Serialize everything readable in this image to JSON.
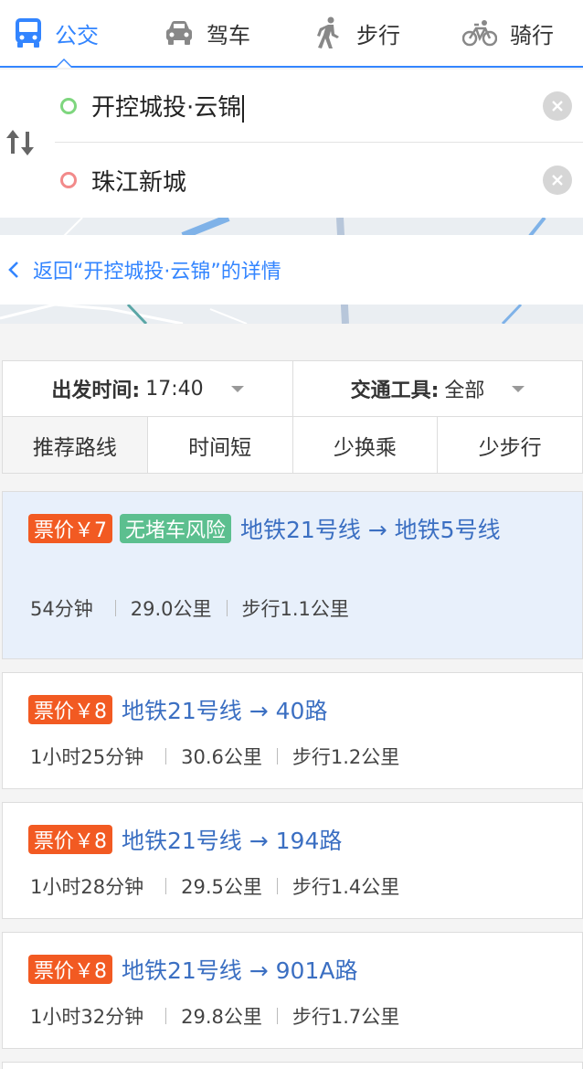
{
  "mode_tabs": [
    {
      "label": "公交",
      "icon": "bus-icon",
      "active": true
    },
    {
      "label": "驾车",
      "icon": "car-icon",
      "active": false
    },
    {
      "label": "步行",
      "icon": "walk-icon",
      "active": false
    },
    {
      "label": "骑行",
      "icon": "bike-icon",
      "active": false
    }
  ],
  "route": {
    "start": "开控城投·云锦",
    "end": "珠江新城"
  },
  "back_link": "返回“开控城投·云锦”的详情",
  "filters": {
    "depart_label": "出发时间:",
    "depart_value": "17:40",
    "vehicle_label": "交通工具:",
    "vehicle_value": "全部"
  },
  "sort_tabs": [
    "推荐路线",
    "时间短",
    "少换乘",
    "少步行"
  ],
  "results": [
    {
      "price": "票价￥7",
      "tag": "无堵车风险",
      "name": "地铁21号线 → 地铁5号线",
      "duration": "54分钟",
      "distance": "29.0公里",
      "walk": "步行1.1公里"
    },
    {
      "price": "票价￥8",
      "name": "地铁21号线 → 40路",
      "duration": "1小时25分钟",
      "distance": "30.6公里",
      "walk": "步行1.2公里"
    },
    {
      "price": "票价￥8",
      "name": "地铁21号线 → 194路",
      "duration": "1小时28分钟",
      "distance": "29.5公里",
      "walk": "步行1.4公里"
    },
    {
      "price": "票价￥8",
      "name": "地铁21号线 → 901A路",
      "duration": "1小时32分钟",
      "distance": "29.8公里",
      "walk": "步行1.7公里"
    }
  ],
  "colors": {
    "accent": "#3385ff",
    "price": "#f25a22",
    "tag": "#5cbf8f",
    "route_name": "#3b6fc2"
  }
}
